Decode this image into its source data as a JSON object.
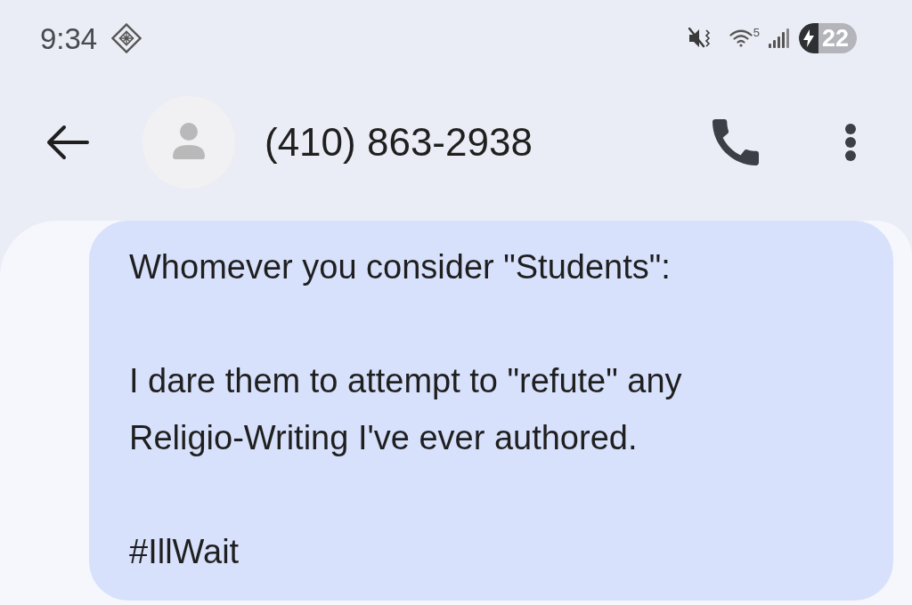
{
  "status_bar": {
    "time": "9:34",
    "wifi_band": "5",
    "battery": "22",
    "charging": true
  },
  "header": {
    "contact": "(410) 863-2938"
  },
  "messages": [
    {
      "text": "Whomever you consider \"Students\":\n\nI dare them to attempt to \"refute\" any Religio-Writing I've ever authored.\n\n#IllWait"
    }
  ]
}
